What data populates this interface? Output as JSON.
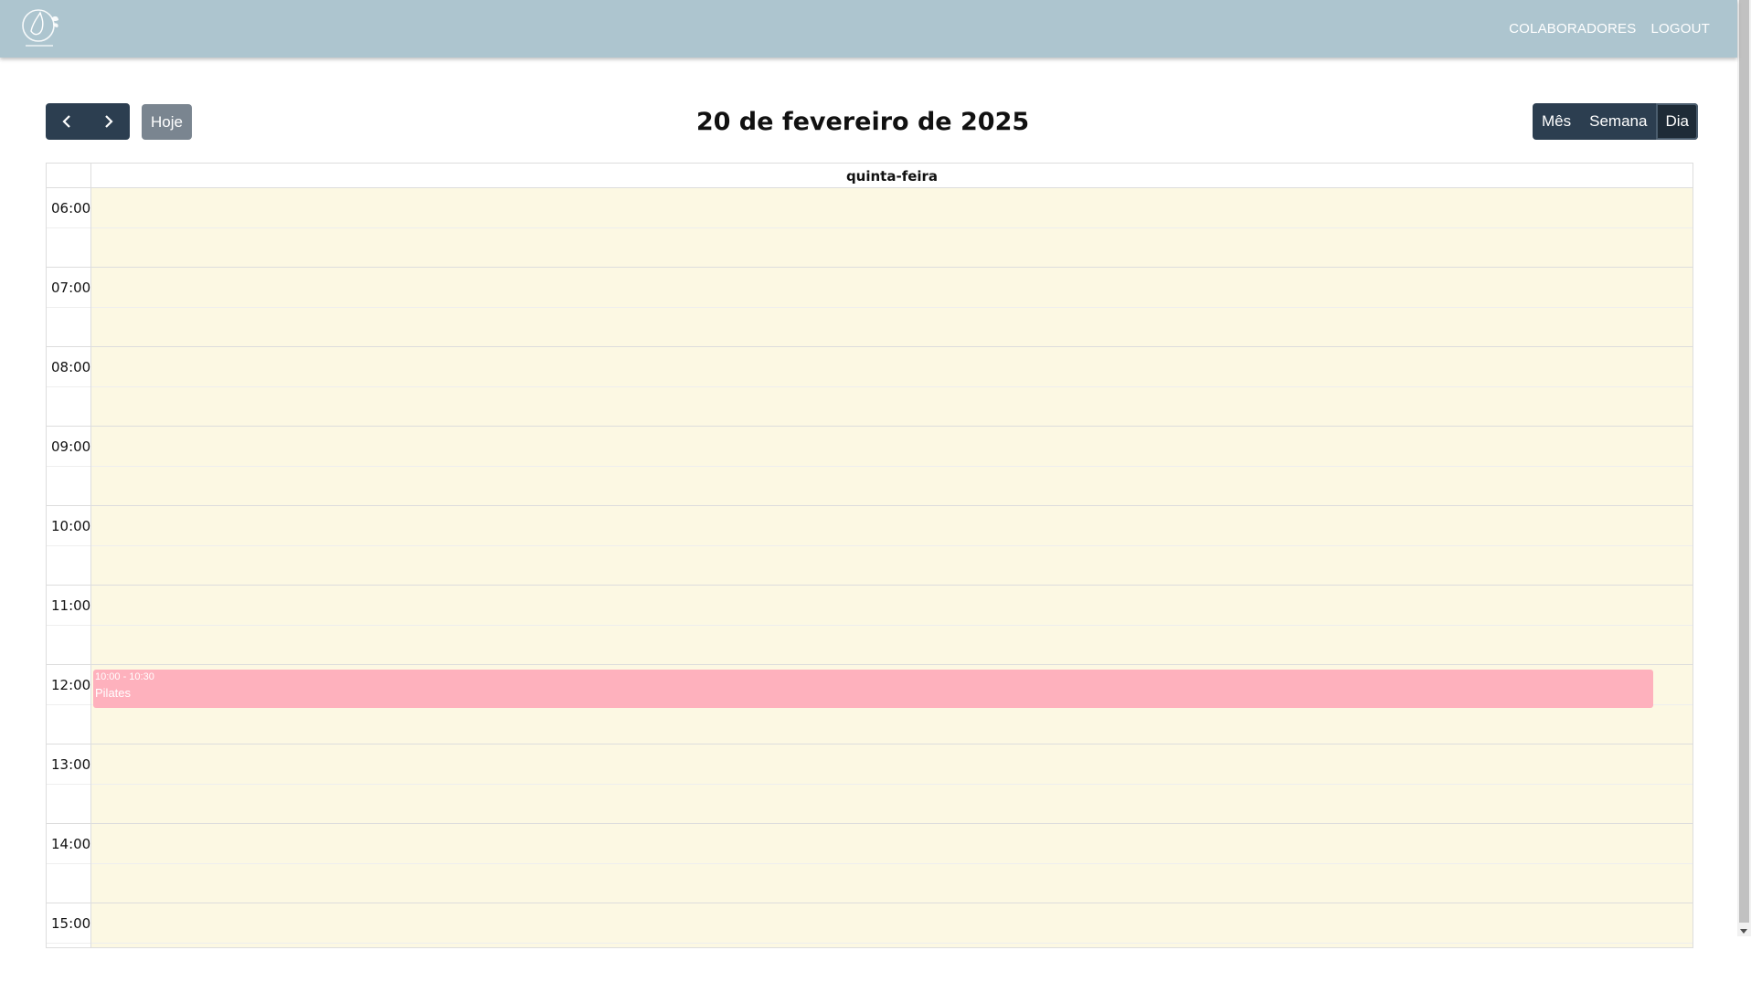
{
  "nav": {
    "links": [
      "COLABORADORES",
      "LOGOUT"
    ]
  },
  "toolbar": {
    "today_label": "Hoje",
    "title": "20 de fevereiro de 2025",
    "views": [
      "Mês",
      "Semana",
      "Dia"
    ],
    "active_view": "Dia"
  },
  "calendar": {
    "day_header": "quinta-feira",
    "hours": [
      "06:00",
      "07:00",
      "08:00",
      "09:00",
      "10:00",
      "11:00",
      "12:00",
      "13:00",
      "14:00",
      "15:00"
    ],
    "background_color": "#fcf8e3",
    "events": [
      {
        "time": "10:00 - 10:30",
        "title": "Pilates",
        "color": "#feb1bd"
      }
    ]
  }
}
